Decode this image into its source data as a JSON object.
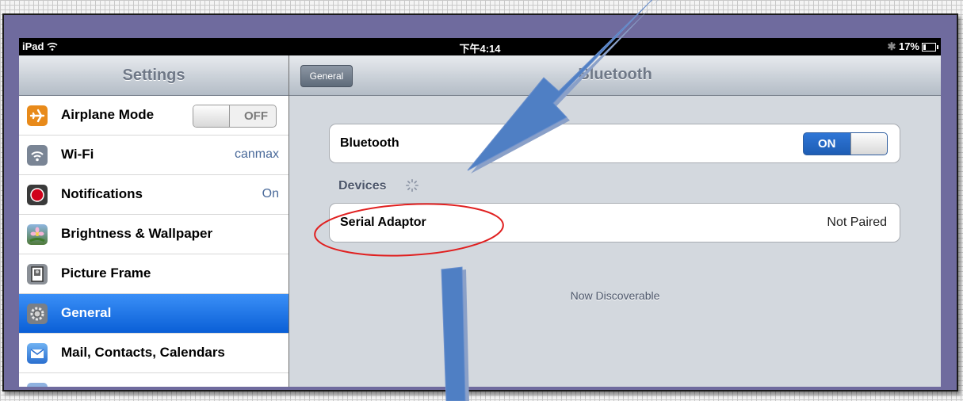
{
  "status_bar": {
    "device": "iPad",
    "time": "下午4:14",
    "battery": "17%"
  },
  "sidebar": {
    "title": "Settings",
    "items": [
      {
        "label": "Airplane Mode",
        "value": "OFF",
        "control": "toggle",
        "icon": "airplane-icon",
        "color": "#e88a1a"
      },
      {
        "label": "Wi-Fi",
        "value": "canmax",
        "icon": "wifi-icon",
        "color": "#7a8595"
      },
      {
        "label": "Notifications",
        "value": "On",
        "icon": "notifications-icon",
        "color": "#d0021b"
      },
      {
        "label": "Brightness & Wallpaper",
        "value": "",
        "icon": "flower-icon",
        "color": "#6b9a3e"
      },
      {
        "label": "Picture Frame",
        "value": "",
        "icon": "picture-frame-icon",
        "color": "#8a8f96"
      },
      {
        "label": "General",
        "value": "",
        "icon": "gear-icon",
        "color": "#7a7f86",
        "selected": true
      },
      {
        "label": "Mail, Contacts, Calendars",
        "value": "",
        "icon": "mail-icon",
        "color": "#3b8ae0"
      }
    ]
  },
  "detail": {
    "back_label": "General",
    "title": "Bluetooth",
    "bluetooth_row": {
      "label": "Bluetooth",
      "toggle": "ON"
    },
    "devices_header": "Devices",
    "device": {
      "name": "Serial Adaptor",
      "status": "Not Paired"
    },
    "footer": "Now Discoverable"
  },
  "colors": {
    "accent": "#0a5fd6",
    "frame": "#6f6b9e",
    "arrow": "#4f7fc4",
    "annotation": "#e02020"
  }
}
